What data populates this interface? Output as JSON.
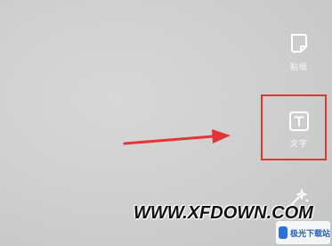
{
  "tools": {
    "sticker": {
      "icon": "sticker-icon",
      "label": "贴纸"
    },
    "text": {
      "icon": "text-icon",
      "label": "文字"
    },
    "effect": {
      "icon": "effect-icon"
    }
  },
  "annotations": {
    "arrow_color": "#e33535",
    "highlight_color": "#e33535"
  },
  "watermark": {
    "text": "WWW.XFDOWN.COM",
    "logo_text": "极光下载站"
  }
}
